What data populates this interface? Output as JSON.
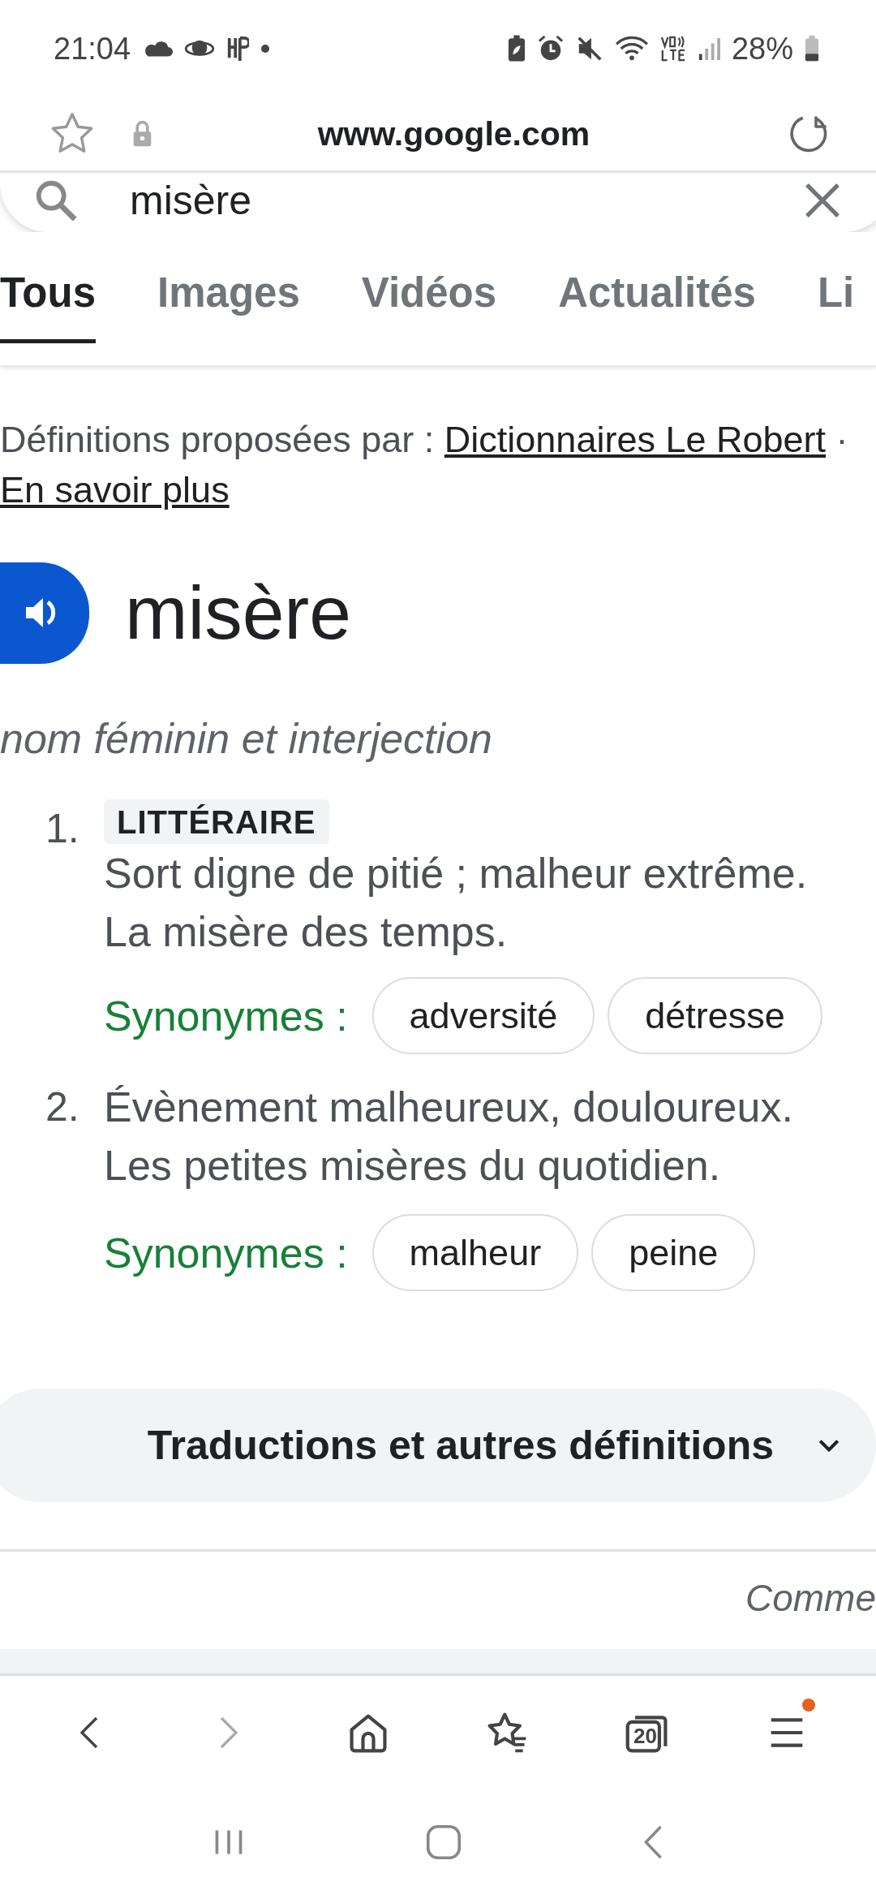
{
  "status_bar": {
    "time": "21:04",
    "battery": "28%"
  },
  "browser": {
    "url": "www.google.com"
  },
  "search": {
    "value": "misère"
  },
  "tabs": [
    {
      "label": "Tous",
      "selected": true
    },
    {
      "label": "Images",
      "selected": false
    },
    {
      "label": "Vidéos",
      "selected": false
    },
    {
      "label": "Actualités",
      "selected": false
    },
    {
      "label": "Li",
      "selected": false
    }
  ],
  "source": {
    "prefix": "Définitions proposées par :",
    "link": "Dictionnaires Le Robert",
    "separator": "·",
    "more_link": "En savoir plus"
  },
  "entry": {
    "word": "misère",
    "grammar": "nom féminin et interjection",
    "senses": [
      {
        "number": "1.",
        "register": "LITTÉRAIRE",
        "definition": "Sort digne de pitié ; malheur extrême.",
        "example": "La misère des temps.",
        "synonyms_label": "Synonymes :",
        "synonyms": [
          "adversité",
          "détresse"
        ]
      },
      {
        "number": "2.",
        "definition": "Évènement malheureux, douloureux.",
        "example": "Les petites misères du quotidien.",
        "synonyms_label": "Synonymes :",
        "synonyms": [
          "malheur",
          "peine"
        ]
      }
    ]
  },
  "more": {
    "label": "Traductions et autres définitions",
    "expanded": false
  },
  "feedback": {
    "label": "Comme"
  },
  "bottom_nav": [
    {
      "kind": "back",
      "disabled": false
    },
    {
      "kind": "forward",
      "disabled": true
    },
    {
      "kind": "home",
      "disabled": false
    },
    {
      "kind": "bookmarks",
      "disabled": false
    },
    {
      "kind": "tabs",
      "count": "20",
      "disabled": false
    },
    {
      "kind": "menu",
      "disabled": false,
      "notification": true
    }
  ]
}
